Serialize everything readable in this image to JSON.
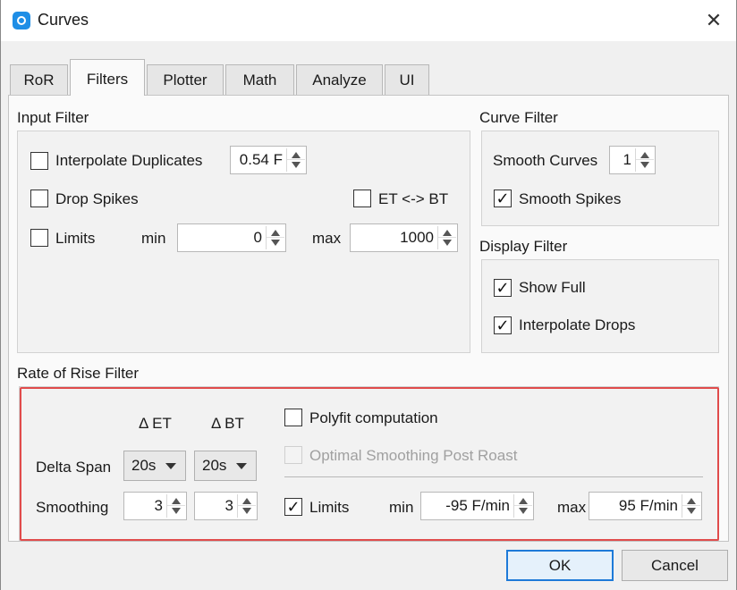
{
  "window": {
    "title": "Curves",
    "close_glyph": "✕"
  },
  "tabs": [
    {
      "label": "RoR"
    },
    {
      "label": "Filters"
    },
    {
      "label": "Plotter"
    },
    {
      "label": "Math"
    },
    {
      "label": "Analyze"
    },
    {
      "label": "UI"
    }
  ],
  "active_tab": "Filters",
  "input_filter": {
    "title": "Input Filter",
    "interpolate_duplicates": {
      "label": "Interpolate Duplicates",
      "checked": false,
      "value": "0.54 F"
    },
    "drop_spikes": {
      "label": "Drop Spikes",
      "checked": false
    },
    "et_bt": {
      "label": "ET <-> BT",
      "checked": false
    },
    "limits": {
      "label": "Limits",
      "checked": false,
      "min_label": "min",
      "min_value": "0",
      "max_label": "max",
      "max_value": "1000"
    }
  },
  "curve_filter": {
    "title": "Curve Filter",
    "smooth_curves": {
      "label": "Smooth Curves",
      "value": "1"
    },
    "smooth_spikes": {
      "label": "Smooth Spikes",
      "checked": true,
      "mark": "✓"
    }
  },
  "display_filter": {
    "title": "Display Filter",
    "show_full": {
      "label": "Show Full",
      "checked": true,
      "mark": "✓"
    },
    "interpolate_drops": {
      "label": "Interpolate Drops",
      "checked": true,
      "mark": "✓"
    }
  },
  "ror_filter": {
    "title": "Rate of Rise Filter",
    "col_et": "Δ ET",
    "col_bt": "Δ BT",
    "delta_span": {
      "label": "Delta Span",
      "et": "20s",
      "bt": "20s"
    },
    "smoothing": {
      "label": "Smoothing",
      "et": "3",
      "bt": "3"
    },
    "polyfit": {
      "label": "Polyfit computation",
      "checked": false
    },
    "optimal_smoothing": {
      "label": "Optimal Smoothing Post Roast",
      "checked": false,
      "enabled": false
    },
    "limits": {
      "label": "Limits",
      "checked": true,
      "mark": "✓",
      "min_label": "min",
      "min_value": "-95 F/min",
      "max_label": "max",
      "max_value": "95 F/min"
    }
  },
  "buttons": {
    "ok": "OK",
    "cancel": "Cancel"
  },
  "colors": {
    "highlight": "#e04b4b",
    "accent": "#1e7ad8",
    "app_icon": "#1e8ee6"
  },
  "icons": {
    "app": "app-logo-icon",
    "close": "close-icon",
    "spin": "spin-arrows-icon",
    "dropdown": "chevron-down-icon"
  }
}
